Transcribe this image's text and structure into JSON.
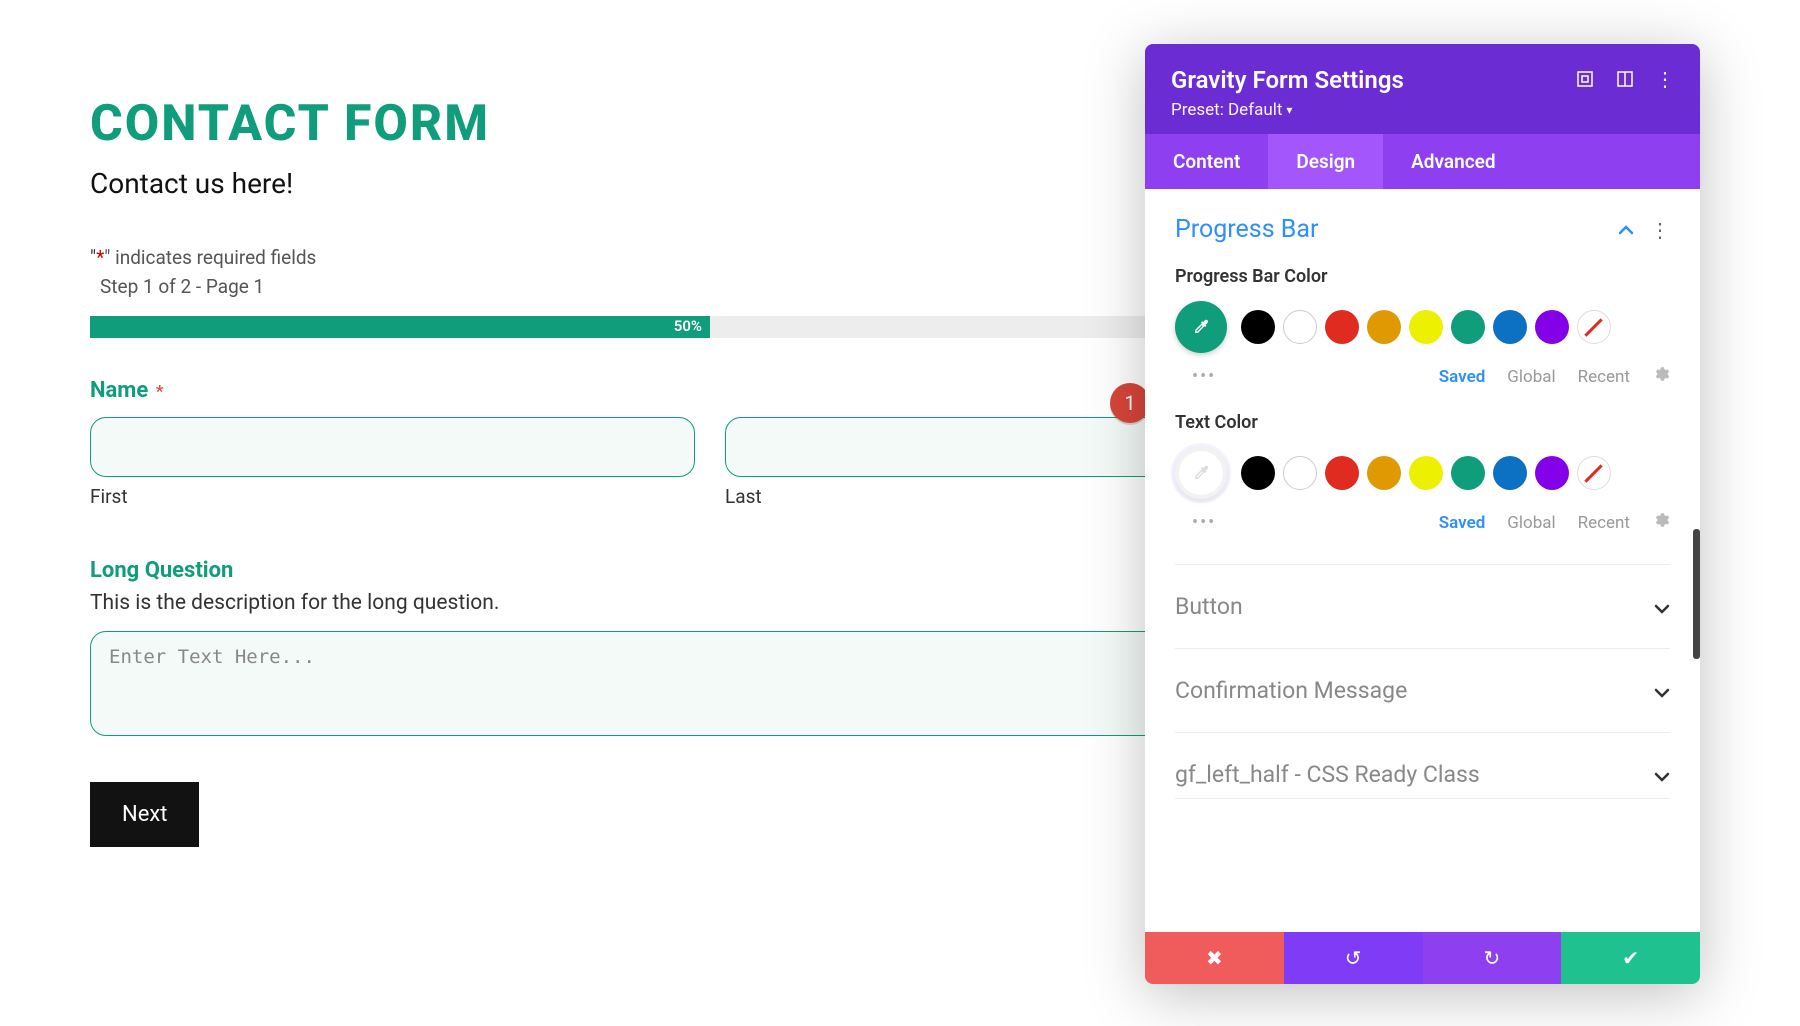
{
  "form": {
    "title": "CONTACT FORM",
    "subtitle": "Contact us here!",
    "required_note_prefix": "\"",
    "required_symbol": "*",
    "required_note_suffix": "\" indicates required fields",
    "step_note": "Step 1 of 2 - Page 1",
    "progress_pct": "50%",
    "name_label": "Name",
    "required_mark": "*",
    "first_label": "First",
    "last_label": "Last",
    "long_q_label": "Long Question",
    "long_q_desc": "This is the description for the long question.",
    "textarea_placeholder": "Enter Text Here...",
    "next_label": "Next"
  },
  "panel": {
    "title": "Gravity Form Settings",
    "preset": "Preset: Default",
    "tabs": {
      "content": "Content",
      "design": "Design",
      "advanced": "Advanced"
    },
    "section_title": "Progress Bar",
    "pb_color_label": "Progress Bar Color",
    "text_color_label": "Text Color",
    "palette_tabs": {
      "saved": "Saved",
      "global": "Global",
      "recent": "Recent"
    },
    "more_dots": "•••",
    "collapse": {
      "button": "Button",
      "confirmation": "Confirmation Message",
      "css": "gf_left_half - CSS Ready Class"
    },
    "colors": {
      "accent_green": "#0f9d7b",
      "header_purple": "#6c2cd3",
      "tab_purple": "#8e3ff0",
      "tab_active_purple": "#a256fb",
      "link_blue": "#2c8eff"
    }
  },
  "badge": "1"
}
